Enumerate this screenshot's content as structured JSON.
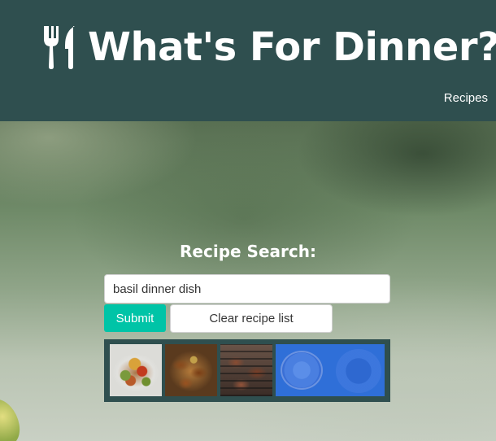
{
  "header": {
    "title": "What's For Dinner?",
    "logo_icon": "utensils-icon",
    "nav_recipes": "Recipes",
    "background_color": "#2f4f4f"
  },
  "search": {
    "title": "Recipe Search:",
    "input_value": "basil dinner dish",
    "submit_label": "Submit",
    "clear_label": "Clear recipe list",
    "accent_color": "#00c4a7"
  },
  "results": {
    "thumbnails": [
      {
        "icon": "food-photo-vegetables"
      },
      {
        "icon": "food-photo-chicken"
      },
      {
        "icon": "food-photo-grill"
      },
      {
        "icon": "food-photo-blue-plate"
      },
      {
        "icon": "food-photo-blue-plate"
      }
    ]
  }
}
